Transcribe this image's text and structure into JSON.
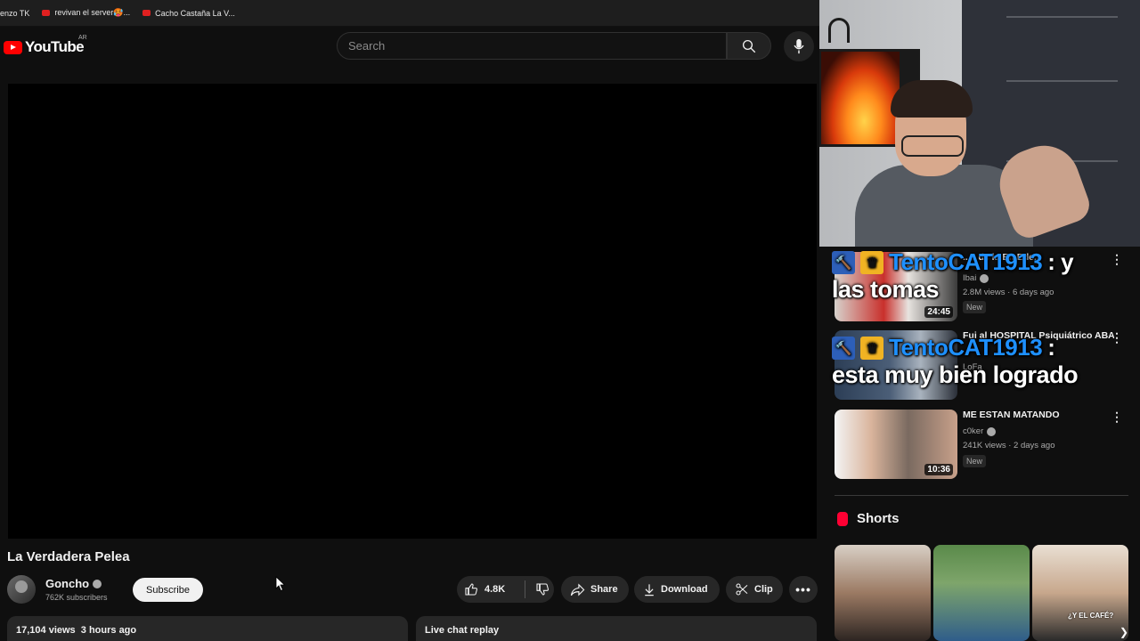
{
  "bookmarks": [
    {
      "label": "enzo TK"
    },
    {
      "label": "revivan el server🥵..."
    },
    {
      "label": "Cacho Castaña La V..."
    }
  ],
  "masthead": {
    "logo_text": "YouTube",
    "country_code": "AR",
    "search_placeholder": "Search"
  },
  "video": {
    "title": "La Verdadera Pelea",
    "channel": "Goncho",
    "subscribers": "762K subscribers",
    "subscribe_label": "Subscribe",
    "likes": "4.8K",
    "share_label": "Share",
    "download_label": "Download",
    "clip_label": "Clip",
    "stats": "17,104 views  3 hours ago",
    "live_chat_label": "Live chat replay"
  },
  "chat_overlay": [
    {
      "user": "TentoCAT1913",
      "sep": ": y",
      "message": "las tomas"
    },
    {
      "user": "TentoCAT1913",
      "sep": ":",
      "message": "esta muy bien logrado"
    }
  ],
  "related": [
    {
      "title": "...a de la En Ede...",
      "channel": "Ibai",
      "meta": "2.8M views · 6 days ago",
      "badge": "New",
      "duration": "24:45"
    },
    {
      "title": "Fui al HOSPITAL Psiquiátrico ABANDONADO de Santa María...",
      "channel": "LoFa",
      "meta": "",
      "badge": "",
      "duration": ""
    },
    {
      "title": "ME ESTAN MATANDO",
      "channel": "c0ker",
      "meta": "241K views · 2 days ago",
      "badge": "New",
      "duration": "10:36"
    }
  ],
  "shorts": {
    "heading": "Shorts",
    "items": [
      {
        "caption": ""
      },
      {
        "caption": ""
      },
      {
        "caption": "¿Y EL CAFÉ?"
      }
    ]
  },
  "colors": {
    "background": "#0f0f0f",
    "brand_red": "#ff0000",
    "chat_user": "#1e90ff"
  }
}
